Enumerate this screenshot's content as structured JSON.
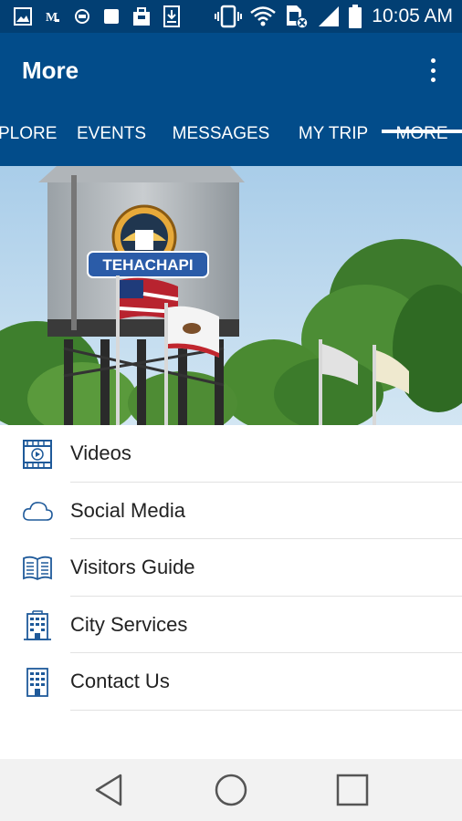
{
  "status_bar": {
    "time": "10:05 AM",
    "left_icons": [
      "image-icon",
      "m-icon",
      "circle-icon",
      "square-icon",
      "briefcase-icon",
      "download-icon"
    ],
    "right_icons": [
      "vibrate-icon",
      "wifi-icon",
      "sim-icon",
      "signal-icon",
      "battery-icon"
    ]
  },
  "app_bar": {
    "title": "More",
    "overflow_icon": "more-vertical-icon"
  },
  "tabs": [
    {
      "label": "PLORE"
    },
    {
      "label": "EVENTS"
    },
    {
      "label": "MESSAGES"
    },
    {
      "label": "MY TRIP"
    },
    {
      "label": "MORE",
      "selected": true
    }
  ],
  "hero": {
    "sign_text": "TEHACHAPI",
    "description_icon": "water-tower-photo"
  },
  "menu": {
    "items": [
      {
        "label": "Videos",
        "icon": "video-icon"
      },
      {
        "label": "Social Media",
        "icon": "cloud-icon"
      },
      {
        "label": "Visitors Guide",
        "icon": "book-icon"
      },
      {
        "label": "City Services",
        "icon": "building-icon"
      },
      {
        "label": "Contact Us",
        "icon": "office-building-icon"
      }
    ]
  },
  "nav_bar": {
    "icons": [
      "back-triangle-icon",
      "home-circle-icon",
      "recents-square-icon"
    ]
  },
  "colors": {
    "status_bar": "#023f73",
    "app_bar": "#024c8a",
    "icon_blue": "#1f5a9a",
    "text": "#222222"
  }
}
